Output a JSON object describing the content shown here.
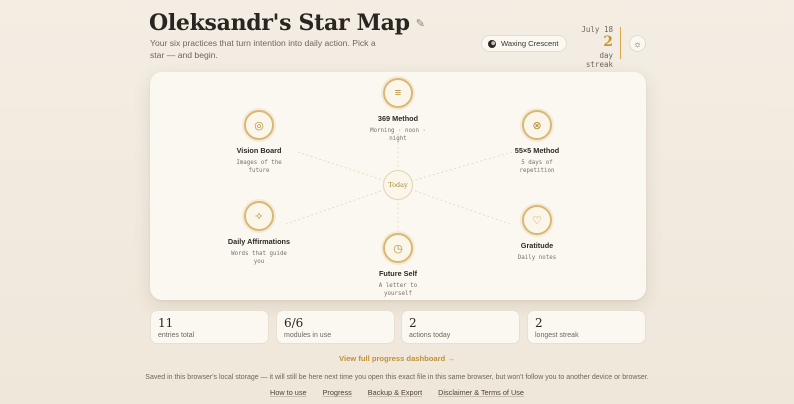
{
  "header": {
    "title": "Oleksandr's Star Map",
    "edit_icon": "pencil-icon",
    "subtitle": "Your six practices that turn intention into daily action. Pick a star — and begin."
  },
  "status": {
    "moon_phase": "Waxing Crescent",
    "date": "July 18",
    "streak_value": "2",
    "streak_label": "day streak",
    "theme_icon": "sun-icon"
  },
  "map": {
    "center_label": "Today",
    "stars": [
      {
        "name": "369 Method",
        "desc": "Morning · noon · night",
        "icon": "lines-icon"
      },
      {
        "name": "Vision Board",
        "desc": "Images of the future",
        "icon": "target-icon"
      },
      {
        "name": "55×5 Method",
        "desc": "5 days of repetition",
        "icon": "cross-circle-icon"
      },
      {
        "name": "Daily Affirmations",
        "desc": "Words that guide you",
        "icon": "sparkle-icon"
      },
      {
        "name": "Gratitude",
        "desc": "Daily notes",
        "icon": "heart-icon"
      },
      {
        "name": "Future Self",
        "desc": "A letter to yourself",
        "icon": "clock-icon"
      }
    ]
  },
  "stats": [
    {
      "value": "11",
      "label": "entries total"
    },
    {
      "value": "6/6",
      "label": "modules in use"
    },
    {
      "value": "2",
      "label": "actions today"
    },
    {
      "value": "2",
      "label": "longest streak"
    }
  ],
  "dashboard_link": "View full progress dashboard →",
  "storage_note": "Saved in this browser's local storage — it will still be here next time you open this exact file in this same browser, but won't follow you to another device or browser.",
  "footer": {
    "links": [
      "How to use",
      "Progress",
      "Backup & Export",
      "Disclaimer & Terms of Use"
    ]
  },
  "colors": {
    "accent": "#c6962f",
    "ring": "#d9b876",
    "background": "#f3ede3"
  }
}
